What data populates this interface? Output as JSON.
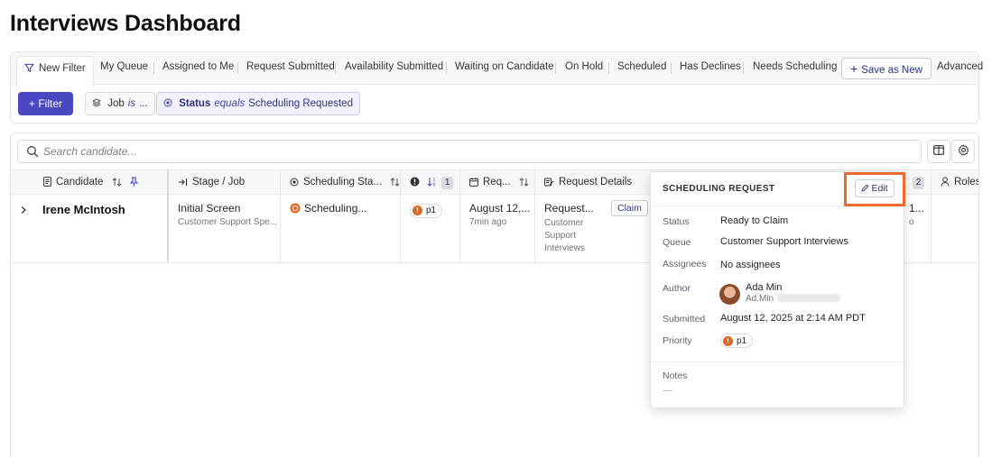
{
  "page": {
    "title": "Interviews Dashboard"
  },
  "tabs": [
    {
      "label": "New Filter",
      "active": true
    },
    {
      "label": "My Queue"
    },
    {
      "label": "Assigned to Me"
    },
    {
      "label": "Request Submitted"
    },
    {
      "label": "Availability Submitted"
    },
    {
      "label": "Waiting on Candidate"
    },
    {
      "label": "On Hold"
    },
    {
      "label": "Scheduled"
    },
    {
      "label": "Has Declines"
    },
    {
      "label": "Needs Scheduling"
    }
  ],
  "toolbar": {
    "save_as_new": "Save as New",
    "advanced": "Advanced",
    "filter_button": "Filter"
  },
  "filters": [
    {
      "key": "Job",
      "op": "is",
      "value": "..."
    },
    {
      "key": "Status",
      "op": "equals",
      "value": "Scheduling Requested"
    }
  ],
  "search": {
    "placeholder": "Search candidate..."
  },
  "columns": {
    "candidate": "Candidate",
    "stage_job": "Stage / Job",
    "scheduling_status": "Scheduling Sta...",
    "priority_count": "1",
    "requested": "Req...",
    "request_details": "Request Details",
    "hidden_count": "2",
    "roles": "Roles"
  },
  "row": {
    "candidate": "Irene McIntosh",
    "stage": "Initial Screen",
    "job": "Customer Support Spe...",
    "scheduling_status": "Scheduling...",
    "priority": "p1",
    "requested_date": "August 12,...",
    "requested_ago": "7min ago",
    "request_title": "Request...",
    "request_queue_line1": "Customer",
    "request_queue_line2": "Support",
    "request_queue_line3": "Interviews",
    "claim": "Claim",
    "partial_right_top": "1...",
    "partial_right_bottom": "o"
  },
  "popover": {
    "title": "SCHEDULING REQUEST",
    "edit": "Edit",
    "status_label": "Status",
    "status_value": "Ready to Claim",
    "queue_label": "Queue",
    "queue_value": "Customer Support Interviews",
    "assignees_label": "Assignees",
    "assignees_value": "No assignees",
    "author_label": "Author",
    "author_name": "Ada Min",
    "author_email": "Ad.Min",
    "submitted_label": "Submitted",
    "submitted_value": "August 12, 2025 at 2:14 AM PDT",
    "priority_label": "Priority",
    "priority_value": "p1",
    "notes_label": "Notes",
    "notes_value": "—"
  },
  "colors": {
    "accent": "#4a47c2",
    "priority": "#e0661f",
    "highlight": "#ea6b2d"
  }
}
